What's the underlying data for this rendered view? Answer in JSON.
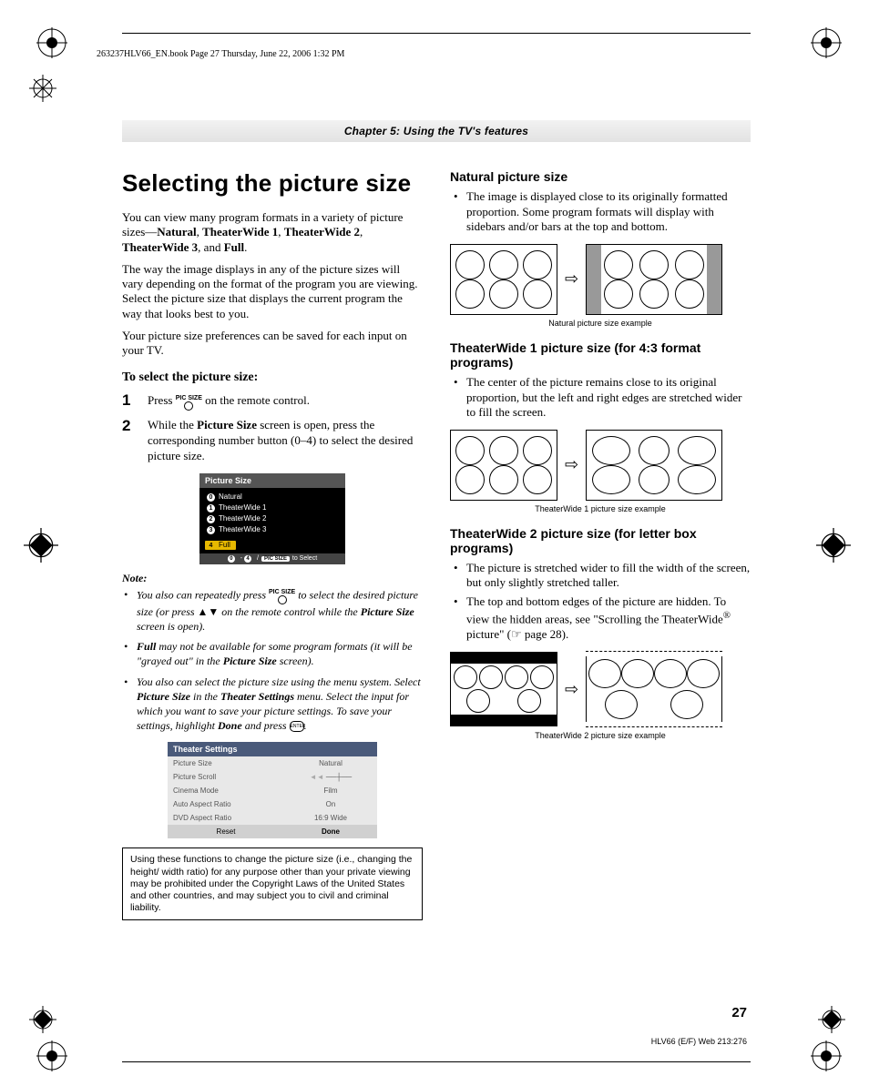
{
  "header": {
    "printline": "263237HLV66_EN.book  Page 27  Thursday, June 22, 2006  1:32 PM"
  },
  "chapter": "Chapter 5: Using the TV's features",
  "left": {
    "h1": "Selecting the picture size",
    "intro1a": "You can view many program formats in a variety of picture sizes—",
    "intro1b": "Natural",
    "intro1c": ", ",
    "intro1d": "TheaterWide 1",
    "intro1e": ", ",
    "intro1f": "TheaterWide 2",
    "intro1g": ", ",
    "intro1h": "TheaterWide 3",
    "intro1i": ", and ",
    "intro1j": "Full",
    "intro1k": ".",
    "p2": "The way the image displays in any of the picture sizes will vary depending on the format of the program you are viewing. Select the picture size that displays the current program the way that looks best to you.",
    "p3": "Your picture size preferences can be saved for each input on your TV.",
    "sub1": "To select the picture size:",
    "step1a": "Press ",
    "step1btn": "PIC SIZE",
    "step1b": " on the remote control.",
    "step2a": "While the ",
    "step2b": "Picture Size",
    "step2c": " screen is open, press the corresponding number button (0–4) to select the desired picture size.",
    "osd": {
      "title": "Picture Size",
      "items": [
        "Natural",
        "TheaterWide 1",
        "TheaterWide 2",
        "TheaterWide 3",
        "Full"
      ],
      "nums": [
        "0",
        "1",
        "2",
        "3",
        "4"
      ],
      "footpill": "PIC SIZE",
      "foot": " to Select"
    },
    "note_label": "Note:",
    "note1a": "You also can repeatedly press ",
    "note1btn": "PIC SIZE",
    "note1b": " to select the desired picture size (or press ▲▼ on the remote control while the ",
    "note1c": "Picture Size",
    "note1d": " screen is open).",
    "note2a": "Full",
    "note2b": " may not be available for some program formats (it will be \"grayed out\" in the ",
    "note2c": "Picture Size",
    "note2d": " screen).",
    "note3a": "You also can select the picture size using the menu system. Select ",
    "note3b": "Picture Size",
    "note3c": " in the ",
    "note3d": "Theater Settings",
    "note3e": " menu. Select the input for which you want to save your picture settings. To save your settings, highlight ",
    "note3f": "Done",
    "note3g": " and press ",
    "note3enter": "ENTER",
    "note3h": ".",
    "settings": {
      "title": "Theater Settings",
      "rows": [
        {
          "k": "Picture Size",
          "v": "Natural"
        },
        {
          "k": "Picture Scroll",
          "v": ""
        },
        {
          "k": "Cinema Mode",
          "v": "Film"
        },
        {
          "k": "Auto Aspect Ratio",
          "v": "On"
        },
        {
          "k": "DVD Aspect Ratio",
          "v": "16:9 Wide"
        }
      ],
      "reset": "Reset",
      "done": "Done"
    },
    "legal": "Using these functions to change the picture size (i.e., changing the height/ width ratio) for any purpose other than your private viewing may be prohibited under the Copyright Laws of the United States and other countries, and may subject you to civil and criminal liability."
  },
  "right": {
    "sec1h": "Natural picture size",
    "sec1b": "The image is displayed close to its originally formatted proportion. Some program formats will display with sidebars and/or bars at the top and bottom.",
    "sec1cap": "Natural picture size example",
    "sec2h": "TheaterWide 1 picture size (for 4:3 format programs)",
    "sec2b": "The center of the picture remains close to its original proportion, but the left and right edges are stretched wider to fill the screen.",
    "sec2cap": "TheaterWide 1 picture size example",
    "sec3h": "TheaterWide 2 picture size (for letter box programs)",
    "sec3b1": "The picture is stretched wider to fill the width of the screen, but only slightly stretched taller.",
    "sec3b2a": "The top and bottom edges of the picture are hidden. To view the hidden areas, see \"Scrolling the TheaterWide",
    "sec3b2b": "®",
    "sec3b2c": " picture\" (☞ page 28).",
    "sec3cap": "TheaterWide 2 picture size example"
  },
  "pagenum": "27",
  "footcode": "HLV66 (E/F) Web 213:276"
}
